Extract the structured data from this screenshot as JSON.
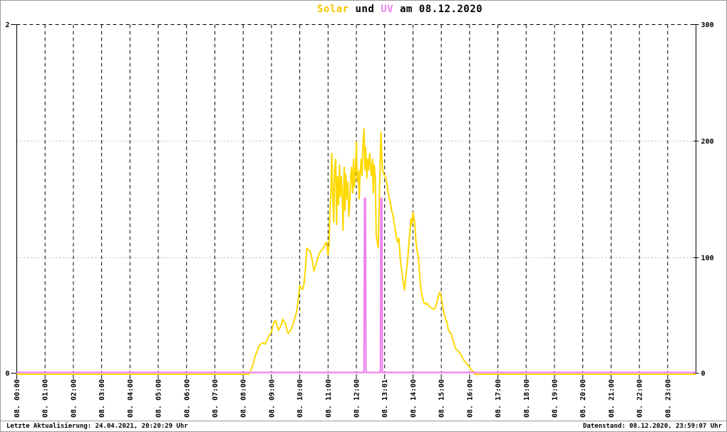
{
  "title": {
    "solar_label": "Solar",
    "mid_text": " und ",
    "uv_label": "UV",
    "date_text": " am 08.12.2020"
  },
  "footer": {
    "last_update": "Letzte Aktualisierung: 24.04.2021, 20:20:29 Uhr",
    "data_state": "Datenstand: 08.12.2020, 23:59:07 Uhr"
  },
  "colors": {
    "solar_line": "#ffd800",
    "uv_line": "#ee82ee",
    "grid_vertical": "#000000",
    "grid_horizontal": "#bbbbbb",
    "axis": "#000000",
    "frame": "#9a9a9a",
    "background": "#ffffff"
  },
  "chart_data": {
    "type": "line",
    "title": "Solar und UV am 08.12.2020",
    "xlabel": "",
    "ylabel_left": "",
    "ylabel_right": "",
    "x_range_hours": [
      0,
      24
    ],
    "left_axis": {
      "range": [
        0,
        2
      ],
      "tick_values": [
        0,
        2
      ],
      "tick_labels": [
        "0",
        "2"
      ]
    },
    "right_axis": {
      "range": [
        0,
        300
      ],
      "tick_values": [
        0,
        100,
        200,
        300
      ],
      "tick_labels": [
        "0",
        "100",
        "200",
        "300"
      ]
    },
    "x_tick_labels": [
      "08. 00:00",
      "08. 01:00",
      "08. 02:00",
      "08. 03:00",
      "08. 04:00",
      "08. 05:00",
      "08. 06:00",
      "08. 07:00",
      "08. 08:00",
      "08. 09:00",
      "08. 10:00",
      "08. 11:00",
      "08. 12:00",
      "08. 13:01",
      "08. 14:00",
      "08. 15:00",
      "08. 16:00",
      "08. 17:00",
      "08. 18:00",
      "08. 19:00",
      "08. 20:00",
      "08. 21:00",
      "08. 22:00",
      "08. 23:00"
    ],
    "grid": {
      "vertical_dashed_black_each_hour": true,
      "horizontal_dotted_gray_at": [
        100,
        200
      ],
      "top_dashed_black_at": 300
    },
    "legend_position": "in-title",
    "series": [
      {
        "name": "Solar",
        "axis": "right",
        "color": "#ffd800",
        "points": [
          [
            0,
            0
          ],
          [
            8.2,
            0
          ],
          [
            8.25,
            2
          ],
          [
            8.3,
            5
          ],
          [
            8.37,
            10
          ],
          [
            8.43,
            16
          ],
          [
            8.5,
            20
          ],
          [
            8.55,
            24
          ],
          [
            8.62,
            26
          ],
          [
            8.7,
            27
          ],
          [
            8.78,
            26
          ],
          [
            8.85,
            30
          ],
          [
            8.93,
            34
          ],
          [
            9,
            36
          ],
          [
            9.05,
            42
          ],
          [
            9.1,
            45
          ],
          [
            9.15,
            46
          ],
          [
            9.2,
            41
          ],
          [
            9.25,
            38
          ],
          [
            9.3,
            40
          ],
          [
            9.35,
            43
          ],
          [
            9.4,
            47
          ],
          [
            9.45,
            45
          ],
          [
            9.5,
            44
          ],
          [
            9.55,
            37
          ],
          [
            9.6,
            35
          ],
          [
            9.65,
            37
          ],
          [
            9.7,
            39
          ],
          [
            9.75,
            42
          ],
          [
            9.8,
            46
          ],
          [
            9.85,
            50
          ],
          [
            9.9,
            55
          ],
          [
            9.95,
            65
          ],
          [
            10,
            76
          ],
          [
            10.05,
            74
          ],
          [
            10.1,
            73
          ],
          [
            10.15,
            77
          ],
          [
            10.2,
            90
          ],
          [
            10.25,
            108
          ],
          [
            10.3,
            107
          ],
          [
            10.35,
            106
          ],
          [
            10.4,
            103
          ],
          [
            10.45,
            96
          ],
          [
            10.5,
            89
          ],
          [
            10.55,
            92
          ],
          [
            10.6,
            97
          ],
          [
            10.65,
            101
          ],
          [
            10.7,
            104
          ],
          [
            10.75,
            106
          ],
          [
            10.8,
            107
          ],
          [
            10.85,
            109
          ],
          [
            10.9,
            112
          ],
          [
            10.95,
            113
          ],
          [
            11,
            102
          ],
          [
            11.03,
            110
          ],
          [
            11.07,
            142
          ],
          [
            11.1,
            155
          ],
          [
            11.13,
            190
          ],
          [
            11.17,
            150
          ],
          [
            11.2,
            130
          ],
          [
            11.23,
            175
          ],
          [
            11.27,
            185
          ],
          [
            11.3,
            128
          ],
          [
            11.33,
            170
          ],
          [
            11.37,
            145
          ],
          [
            11.4,
            180
          ],
          [
            11.43,
            152
          ],
          [
            11.47,
            170
          ],
          [
            11.5,
            155
          ],
          [
            11.53,
            123
          ],
          [
            11.57,
            178
          ],
          [
            11.6,
            140
          ],
          [
            11.63,
            172
          ],
          [
            11.67,
            150
          ],
          [
            11.7,
            165
          ],
          [
            11.73,
            135
          ],
          [
            11.77,
            150
          ],
          [
            11.8,
            170
          ],
          [
            11.83,
            178
          ],
          [
            11.87,
            155
          ],
          [
            11.9,
            185
          ],
          [
            11.93,
            160
          ],
          [
            11.97,
            178
          ],
          [
            12,
            200
          ],
          [
            12.03,
            165
          ],
          [
            12.07,
            175
          ],
          [
            12.1,
            150
          ],
          [
            12.13,
            172
          ],
          [
            12.17,
            185
          ],
          [
            12.2,
            170
          ],
          [
            12.23,
            195
          ],
          [
            12.27,
            211
          ],
          [
            12.3,
            175
          ],
          [
            12.33,
            195
          ],
          [
            12.37,
            168
          ],
          [
            12.4,
            185
          ],
          [
            12.43,
            175
          ],
          [
            12.47,
            190
          ],
          [
            12.5,
            178
          ],
          [
            12.53,
            170
          ],
          [
            12.57,
            185
          ],
          [
            12.6,
            155
          ],
          [
            12.63,
            180
          ],
          [
            12.67,
            168
          ],
          [
            12.7,
            120
          ],
          [
            12.73,
            115
          ],
          [
            12.77,
            108
          ],
          [
            12.8,
            140
          ],
          [
            12.83,
            170
          ],
          [
            12.87,
            208
          ],
          [
            12.9,
            185
          ],
          [
            12.93,
            175
          ],
          [
            12.97,
            172
          ],
          [
            13,
            170
          ],
          [
            13.05,
            168
          ],
          [
            13.1,
            160
          ],
          [
            13.15,
            152
          ],
          [
            13.2,
            148
          ],
          [
            13.25,
            140
          ],
          [
            13.3,
            136
          ],
          [
            13.35,
            127
          ],
          [
            13.4,
            120
          ],
          [
            13.45,
            113
          ],
          [
            13.5,
            117
          ],
          [
            13.55,
            100
          ],
          [
            13.6,
            90
          ],
          [
            13.65,
            80
          ],
          [
            13.7,
            72
          ],
          [
            13.75,
            85
          ],
          [
            13.8,
            95
          ],
          [
            13.85,
            110
          ],
          [
            13.9,
            125
          ],
          [
            13.93,
            134
          ],
          [
            13.97,
            128
          ],
          [
            14,
            139
          ],
          [
            14.03,
            135
          ],
          [
            14.07,
            128
          ],
          [
            14.1,
            115
          ],
          [
            14.15,
            105
          ],
          [
            14.2,
            99
          ],
          [
            14.25,
            80
          ],
          [
            14.3,
            70
          ],
          [
            14.35,
            64
          ],
          [
            14.4,
            61
          ],
          [
            14.45,
            60
          ],
          [
            14.5,
            61
          ],
          [
            14.55,
            59
          ],
          [
            14.6,
            58
          ],
          [
            14.65,
            57
          ],
          [
            14.7,
            56
          ],
          [
            14.75,
            56
          ],
          [
            14.8,
            58
          ],
          [
            14.85,
            62
          ],
          [
            14.9,
            68
          ],
          [
            14.95,
            70
          ],
          [
            15,
            66
          ],
          [
            15.05,
            58
          ],
          [
            15.1,
            52
          ],
          [
            15.15,
            47
          ],
          [
            15.2,
            45
          ],
          [
            15.25,
            38
          ],
          [
            15.3,
            36
          ],
          [
            15.35,
            35
          ],
          [
            15.4,
            30
          ],
          [
            15.45,
            26
          ],
          [
            15.5,
            22
          ],
          [
            15.55,
            21
          ],
          [
            15.6,
            20
          ],
          [
            15.65,
            18
          ],
          [
            15.7,
            17
          ],
          [
            15.75,
            14
          ],
          [
            15.8,
            12
          ],
          [
            15.85,
            10
          ],
          [
            15.9,
            9
          ],
          [
            15.95,
            8
          ],
          [
            16,
            6
          ],
          [
            16.05,
            4
          ],
          [
            16.1,
            3
          ],
          [
            16.15,
            1
          ],
          [
            16.2,
            0
          ],
          [
            24,
            0
          ]
        ]
      },
      {
        "name": "UV",
        "axis": "left",
        "color": "#ee82ee",
        "points": [
          [
            0,
            0
          ],
          [
            12.27,
            0
          ],
          [
            12.28,
            0.5
          ],
          [
            12.29,
            1
          ],
          [
            12.32,
            1
          ],
          [
            12.33,
            0.5
          ],
          [
            12.34,
            0
          ],
          [
            12.85,
            0
          ],
          [
            12.86,
            0.5
          ],
          [
            12.87,
            1
          ],
          [
            12.9,
            1
          ],
          [
            12.91,
            0.5
          ],
          [
            12.92,
            0
          ],
          [
            24,
            0
          ]
        ]
      }
    ]
  }
}
